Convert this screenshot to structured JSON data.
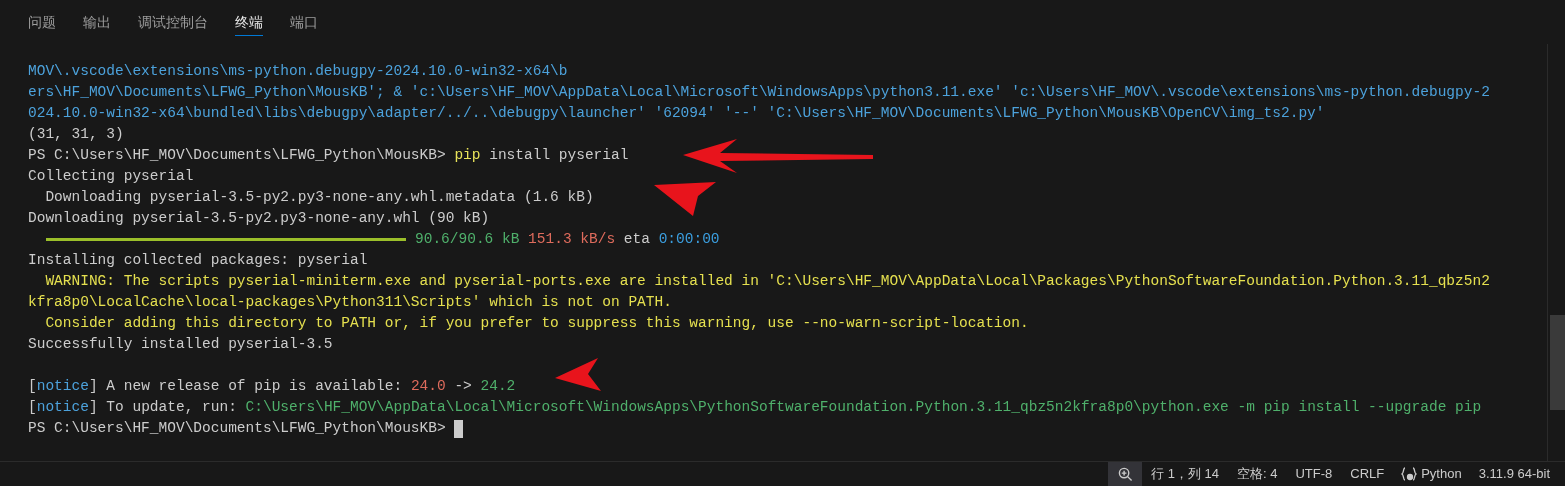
{
  "panel_tabs": [
    {
      "label": "问题",
      "selected": false
    },
    {
      "label": "输出",
      "selected": false
    },
    {
      "label": "调试控制台",
      "selected": false
    },
    {
      "label": "终端",
      "selected": true
    },
    {
      "label": "端口",
      "selected": false
    }
  ],
  "terminal_lines": [
    {
      "kind": "text",
      "segments": [
        {
          "text": "MOV\\.vscode\\extensions\\ms-python.debugpy-2024.10.0-win32-x64\\b",
          "kind": "path"
        }
      ]
    },
    {
      "kind": "text",
      "segments": [
        {
          "text": "ers\\HF_MOV\\Documents\\LFWG_Python\\MousKB'; & 'c:\\Users\\HF_MOV\\AppData\\Local\\Microsoft\\WindowsApps\\python3.11.exe' 'c:\\Users\\HF_MOV\\.vscode\\extensions\\ms-python.debugpy-2",
          "kind": "path"
        }
      ]
    },
    {
      "kind": "text",
      "segments": [
        {
          "text": "024.10.0-win32-x64\\bundled\\libs\\debugpy\\adapter/../..\\debugpy\\launcher' '62094' '--' 'C:\\Users\\HF_MOV\\Documents\\LFWG_Python\\MousKB\\OpenCV\\img_ts2.py'",
          "kind": "path"
        }
      ]
    },
    {
      "kind": "text",
      "segments": [
        {
          "text": "(31, 31, 3)",
          "kind": "plain"
        }
      ]
    },
    {
      "kind": "text",
      "segments": [
        {
          "text": "PS C:\\Users\\HF_MOV\\Documents\\LFWG_Python\\MousKB> ",
          "kind": "plain"
        },
        {
          "text": "pip",
          "kind": "command"
        },
        {
          "text": " install pyserial",
          "kind": "plain"
        }
      ]
    },
    {
      "kind": "text",
      "segments": [
        {
          "text": "Collecting pyserial",
          "kind": "plain"
        }
      ]
    },
    {
      "kind": "text",
      "segments": [
        {
          "text": "  Downloading pyserial-3.5-py2.py3-none-any.whl.metadata (1.6 kB)",
          "kind": "plain"
        }
      ]
    },
    {
      "kind": "text",
      "segments": [
        {
          "text": "Downloading pyserial-3.5-py2.py3-none-any.whl (90 kB)",
          "kind": "plain"
        }
      ]
    },
    {
      "kind": "progress",
      "level": 1,
      "segments": [
        {
          "text": "90.6/90.6 kB",
          "kind": "good"
        },
        {
          "text": " 151.3 kB/s",
          "kind": "bad"
        },
        {
          "text": " eta ",
          "kind": "plain"
        },
        {
          "text": "0:00:00",
          "kind": "info"
        }
      ]
    },
    {
      "kind": "text",
      "segments": [
        {
          "text": "Installing collected packages: pyserial",
          "kind": "plain"
        }
      ]
    },
    {
      "kind": "text",
      "segments": [
        {
          "text": "  WARNING: The scripts pyserial-miniterm.exe and pyserial-ports.exe are installed in 'C:\\Users\\HF_MOV\\AppData\\Local\\Packages\\PythonSoftwareFoundation.Python.3.11_qbz5n2",
          "kind": "warning"
        }
      ]
    },
    {
      "kind": "text",
      "segments": [
        {
          "text": "kfra8p0\\LocalCache\\local-packages\\Python311\\Scripts' which is not on PATH.",
          "kind": "warning"
        }
      ]
    },
    {
      "kind": "text",
      "segments": [
        {
          "text": "  Consider adding this directory to PATH or, if you prefer to suppress this warning, use --no-warn-script-location.",
          "kind": "warning"
        }
      ]
    },
    {
      "kind": "text",
      "segments": [
        {
          "text": "Successfully installed pyserial-3.5",
          "kind": "plain"
        }
      ]
    },
    {
      "kind": "blank"
    },
    {
      "kind": "text",
      "segments": [
        {
          "text": "[",
          "kind": "plain"
        },
        {
          "text": "notice",
          "kind": "path"
        },
        {
          "text": "] A new release of pip is available: ",
          "kind": "plain"
        },
        {
          "text": "24.0",
          "kind": "bad"
        },
        {
          "text": " -> ",
          "kind": "plain"
        },
        {
          "text": "24.2",
          "kind": "good"
        }
      ]
    },
    {
      "kind": "text",
      "segments": [
        {
          "text": "[",
          "kind": "plain"
        },
        {
          "text": "notice",
          "kind": "path"
        },
        {
          "text": "] To update, run: ",
          "kind": "plain"
        },
        {
          "text": "C:\\Users\\HF_MOV\\AppData\\Local\\Microsoft\\WindowsApps\\PythonSoftwareFoundation.Python.3.11_qbz5n2kfra8p0\\python.exe -m pip install --upgrade pip",
          "kind": "good"
        }
      ]
    },
    {
      "kind": "prompt",
      "segments": [
        {
          "text": "PS C:\\Users\\HF_MOV\\Documents\\LFWG_Python\\MousKB> ",
          "kind": "plain"
        }
      ]
    }
  ],
  "status_bar": [
    {
      "kind": "zoom"
    },
    {
      "kind": "text",
      "text": "行 1，列 14"
    },
    {
      "kind": "text",
      "text": "空格: 4"
    },
    {
      "kind": "text",
      "text": "UTF-8"
    },
    {
      "kind": "text",
      "text": "CRLF"
    },
    {
      "kind": "language",
      "text": "Python"
    },
    {
      "kind": "text",
      "text": "3.11.9 64-bit"
    }
  ]
}
